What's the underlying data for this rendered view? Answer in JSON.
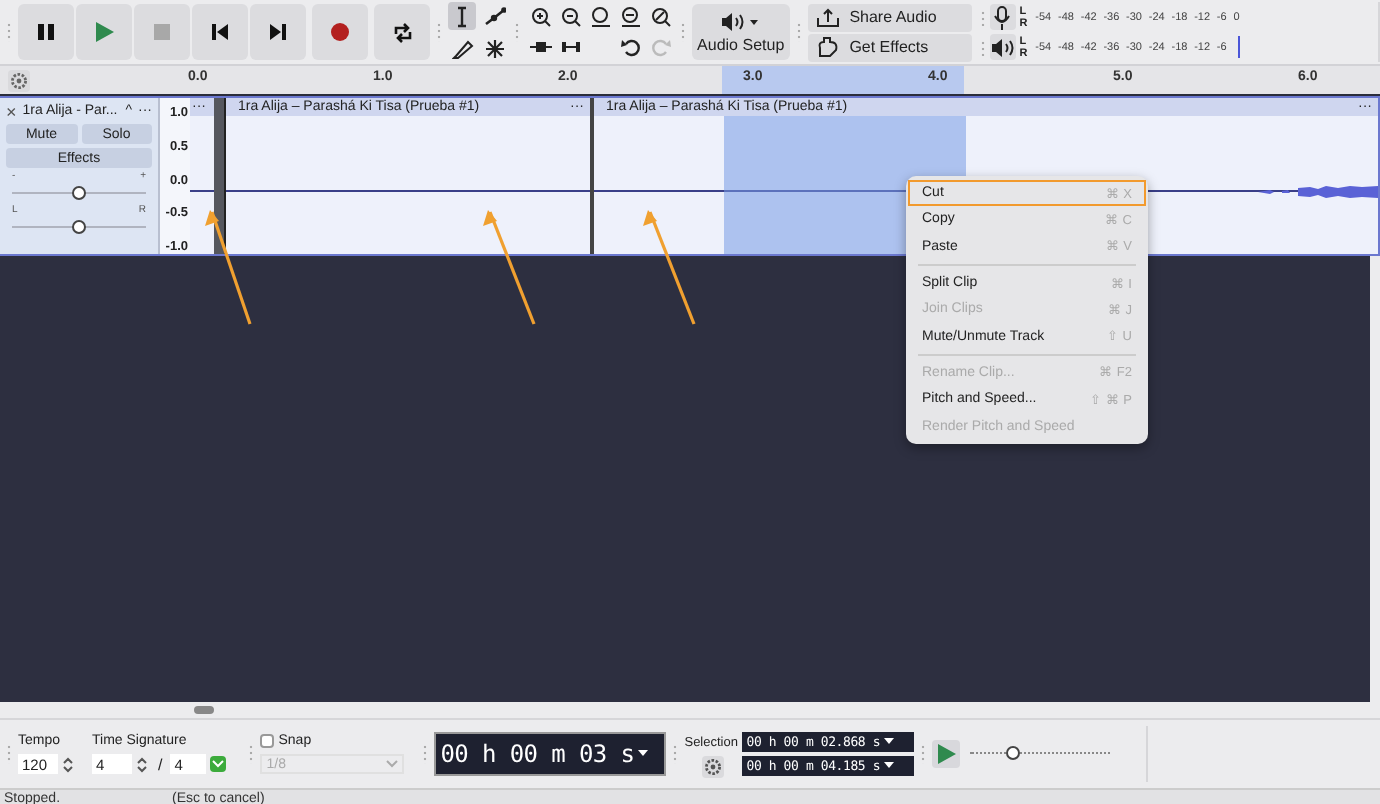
{
  "tools": [
    {
      "kind": "select",
      "selected": true
    },
    {
      "kind": "envelope",
      "selected": false
    },
    {
      "kind": "draw",
      "selected": false
    },
    {
      "kind": "multi",
      "selected": false
    }
  ],
  "audio_setup": "Audio Setup",
  "share_audio": "Share Audio",
  "get_effects": "Get Effects",
  "meters": [
    {
      "kind": "record",
      "channels": [
        "L",
        "R"
      ],
      "ticks": [
        "-54",
        "-48",
        "-42",
        "-36",
        "-30",
        "-24",
        "-18",
        "-12",
        "-6",
        "0"
      ]
    },
    {
      "kind": "playback",
      "channels": [
        "L",
        "R"
      ],
      "ticks": [
        "-54",
        "-48",
        "-42",
        "-36",
        "-30",
        "-24",
        "-18",
        "-12",
        "-6"
      ]
    }
  ],
  "ruler": {
    "ticks": [
      "0.0",
      "1.0",
      "2.0",
      "3.0",
      "4.0",
      "5.0",
      "6.0"
    ]
  },
  "track": {
    "close": "×",
    "name": "1ra Alija - Par...",
    "collapse": "^",
    "menu": "···",
    "mute": "Mute",
    "solo": "Solo",
    "effects": "Effects",
    "gain": {
      "minus": "-",
      "plus": "+",
      "level": 0.5
    },
    "pan": {
      "left": "L",
      "right": "R",
      "level": 0.5
    },
    "scale": [
      "1.0",
      "0.5",
      "0.0",
      "-0.5",
      "-1.0"
    ]
  },
  "clips": [
    {
      "menu": "···"
    },
    {
      "title": "1ra Alija – Parashá Ki Tisa (Prueba #1)",
      "menu": "···"
    },
    {
      "title": "1ra Alija – Parashá Ki Tisa (Prueba #1)",
      "menu": "···"
    }
  ],
  "context_menu": [
    {
      "kind": "item",
      "label": "Cut",
      "shortcut": "⌘ X",
      "disabled": false,
      "selected": true
    },
    {
      "kind": "item",
      "label": "Copy",
      "shortcut": "⌘ C",
      "disabled": false,
      "selected": false
    },
    {
      "kind": "item",
      "label": "Paste",
      "shortcut": "⌘ V",
      "disabled": false,
      "selected": false
    },
    {
      "kind": "separator"
    },
    {
      "kind": "item",
      "label": "Split Clip",
      "shortcut": "⌘ I",
      "disabled": false,
      "selected": false
    },
    {
      "kind": "item",
      "label": "Join Clips",
      "shortcut": "⌘ J",
      "disabled": true,
      "selected": false
    },
    {
      "kind": "item",
      "label": "Mute/Unmute Track",
      "shortcut": "⇧ U",
      "disabled": false,
      "selected": false
    },
    {
      "kind": "separator"
    },
    {
      "kind": "item",
      "label": "Rename Clip...",
      "shortcut": "⌘ F2",
      "disabled": true,
      "selected": false
    },
    {
      "kind": "item",
      "label": "Pitch and Speed...",
      "shortcut": "⇧ ⌘ P",
      "disabled": false,
      "selected": false
    },
    {
      "kind": "item",
      "label": "Render Pitch and Speed",
      "disabled": true,
      "selected": false
    }
  ],
  "bottom": {
    "tempo": {
      "label": "Tempo",
      "value": "120"
    },
    "time_signature": {
      "label": "Time Signature",
      "upper": "4",
      "slash": "/",
      "lower": "4"
    },
    "snap": {
      "label": "Snap",
      "checked": false,
      "value": "1/8"
    },
    "time": "00 h 00 m 03 s",
    "selection": {
      "label": "Selection",
      "start": "00 h 00 m 02.868 s",
      "end": "00 h 00 m 04.185 s"
    },
    "play_at_speed": {
      "level": 0.3
    }
  },
  "status": [
    "Stopped.",
    "(Esc to cancel)"
  ],
  "annotation_arrows": [
    {
      "kind": "arrow"
    },
    {
      "kind": "arrow"
    },
    {
      "kind": "arrow"
    }
  ]
}
